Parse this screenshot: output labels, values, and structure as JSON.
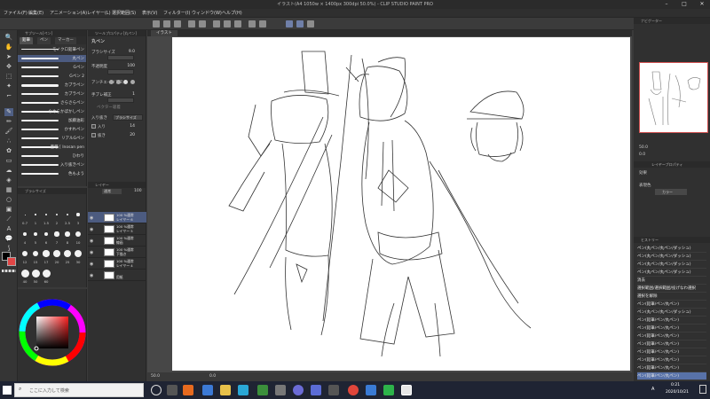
{
  "app": {
    "title": "イラスト(A4 1050w × 1400px 300dpi 50.0%) - CLIP STUDIO PAINT PRO"
  },
  "menu": [
    "ファイル(F)",
    "編集(E)",
    "アニメーション(A)",
    "レイヤー(L)",
    "選択範囲(S)",
    "表示(V)",
    "フィルター(I)",
    "ウィンドウ(W)",
    "ヘルプ(H)"
  ],
  "subtool": {
    "header": "サブツール[ペン]",
    "tabs": [
      "鉛筆",
      "ペン",
      "マーカー"
    ],
    "brushes": [
      "モノクロ鉛筆ペン",
      "丸ペン",
      "Gペン",
      "Gペン 2",
      "カブラペン",
      "カブラペン",
      "さらさらペン",
      "なめらかぼかしペン",
      "加藤油彩",
      "かすれペン",
      "リアルGペン",
      "豊穣 [ Inosan pen",
      "ひわり",
      "入り抜きペン",
      "色もよう"
    ]
  },
  "toolprop": {
    "header": "ツールプロパティ[丸ペン]",
    "name": "丸ペン",
    "props": [
      {
        "label": "ブラシサイズ",
        "value": "9.0"
      },
      {
        "label": "不透明度",
        "value": "100"
      },
      {
        "label": "アンチエイリアス",
        "value": ""
      },
      {
        "label": "手ブレ補正",
        "value": "1"
      },
      {
        "label": "ベクター吸着",
        "value": ""
      }
    ],
    "inout_label": "入り抜き",
    "inout_value": "ブラシサイズ",
    "chk1": "入り",
    "chk1_val": "14",
    "chk2": "抜き",
    "chk2_val": "20"
  },
  "colorset": {
    "header": "ブラシサイズ",
    "sizes": [
      "0.7",
      "1",
      "1.5",
      "2",
      "2.5",
      "3",
      "4",
      "5",
      "6",
      "7",
      "8",
      "10",
      "12",
      "15",
      "17",
      "20",
      "25",
      "30",
      "40",
      "50",
      "60"
    ]
  },
  "layers": {
    "header": "レイヤー",
    "blend": "通常",
    "opacity": "100",
    "items": [
      {
        "pct": "100 %通常",
        "name": "レイヤー 6"
      },
      {
        "pct": "100 %通常",
        "name": "レイヤー 5"
      },
      {
        "pct": "100 %通常",
        "name": "線画"
      },
      {
        "pct": "100 %通常",
        "name": "下描き"
      },
      {
        "pct": "100 %通常",
        "name": "レイヤー 4"
      },
      {
        "pct": "",
        "name": "用紙"
      }
    ]
  },
  "canvas": {
    "tab": "イラスト",
    "zoom": "50.0",
    "angle": "0.0"
  },
  "rightpanel": {
    "header": "ナビゲーター",
    "zoom": "50.0",
    "angle": "0.0",
    "layerprop_tab": "レイヤープロパティ",
    "effect_label": "効果",
    "express_label": "表現色",
    "express_value": "カラー",
    "history_header": "ヒストリー",
    "history": [
      "ペン(丸ペン/丸ペン/ダッシュ)",
      "ペン(丸ペン/丸ペン/ダッシュ)",
      "ペン(丸ペン/丸ペン/ダッシュ)",
      "ペン(丸ペン/丸ペン/ダッシュ)",
      "消去",
      "選択範囲/選択範囲/投げなわ選択",
      "選択を解除",
      "ペン(鉛筆/ペン/丸ペン)",
      "ペン(丸ペン/丸ペン/ダッシュ)",
      "ペン(鉛筆/ペン/丸ペン)",
      "ペン(鉛筆/ペン/丸ペン)",
      "ペン(鉛筆/ペン/丸ペン)",
      "ペン(鉛筆/ペン/丸ペン)",
      "ペン(鉛筆/ペン/丸ペン)",
      "ペン(鉛筆/ペン/丸ペン)",
      "ペン(鉛筆/ペン/丸ペン)",
      "ペン(鉛筆/ペン/丸ペン)"
    ]
  },
  "taskbar": {
    "search_placeholder": "ここに入力して検索",
    "time": "0:21",
    "date": "2020/10/21",
    "ime": "A"
  },
  "colors": {
    "accent": "#5872a8",
    "selected_layer": "#4c5b80",
    "nav_frame": "#d05050"
  }
}
